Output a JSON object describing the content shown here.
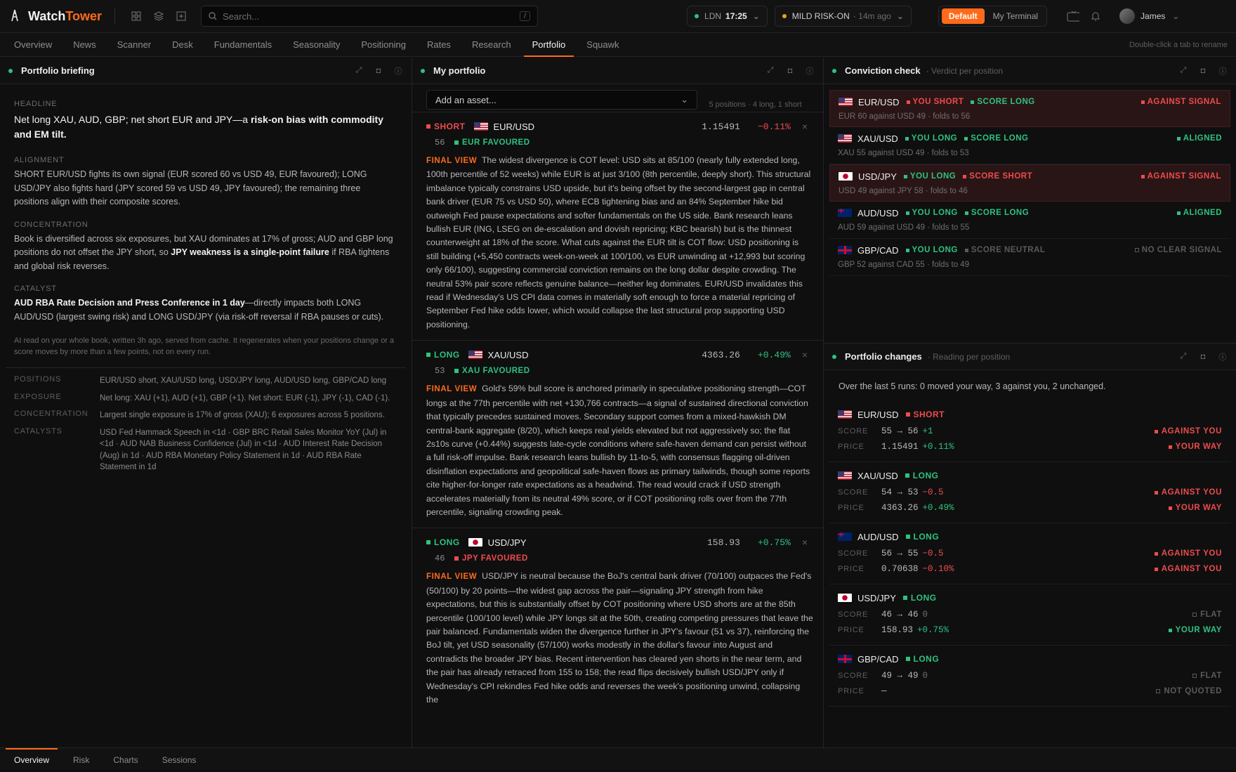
{
  "app": {
    "name_part1": "Watch",
    "name_part2": "Tower"
  },
  "search": {
    "placeholder": "Search...",
    "shortcut": "/"
  },
  "market": {
    "city": "LDN",
    "time": "17:25",
    "regime": "MILD RISK-ON",
    "regime_age": "· 14m ago"
  },
  "layout_toggle": {
    "active": "Default",
    "inactive": "My Terminal"
  },
  "user": {
    "name": "James"
  },
  "nav": {
    "tabs": [
      "Overview",
      "News",
      "Scanner",
      "Desk",
      "Fundamentals",
      "Seasonality",
      "Positioning",
      "Rates",
      "Research",
      "Portfolio",
      "Squawk"
    ],
    "active": "Portfolio",
    "hint": "Double-click a tab to rename"
  },
  "briefing": {
    "title": "Portfolio briefing",
    "headline_label": "HEADLINE",
    "headline_a": "Net long XAU, AUD, GBP; net short EUR and JPY—a ",
    "headline_b": "risk-on bias with commodity and EM tilt.",
    "alignment_label": "ALIGNMENT",
    "alignment_text": "SHORT EUR/USD fights its own signal (EUR scored 60 vs USD 49, EUR favoured); LONG USD/JPY also fights hard (JPY scored 59 vs USD 49, JPY favoured); the remaining three positions align with their composite scores.",
    "concentration_label": "CONCENTRATION",
    "concentration_a": "Book is diversified across six exposures, but XAU dominates at 17% of gross; AUD and GBP long positions do not offset the JPY short, so ",
    "concentration_b": "JPY weakness is a single-point failure",
    "concentration_c": " if RBA tightens and global risk reverses.",
    "catalyst_label": "CATALYST",
    "catalyst_a": "AUD RBA Rate Decision and Press Conference in 1 day",
    "catalyst_b": "—directly impacts both LONG AUD/USD (largest swing risk) and LONG USD/JPY (via risk-off reversal if RBA pauses or cuts).",
    "meta": "AI read on your whole book, written 3h ago, served from cache. It regenerates when your positions change or a score moves by more than a few points, not on every run.",
    "facts": [
      {
        "k": "POSITIONS",
        "v": "EUR/USD short, XAU/USD long, USD/JPY long, AUD/USD long, GBP/CAD long"
      },
      {
        "k": "EXPOSURE",
        "v": "Net long: XAU (+1), AUD (+1), GBP (+1). Net short: EUR (-1), JPY (-1), CAD (-1)."
      },
      {
        "k": "CONCENTRATION",
        "v": "Largest single exposure is 17% of gross (XAU); 6 exposures across 5 positions."
      },
      {
        "k": "CATALYSTS",
        "v": "USD Fed Hammack Speech in <1d · GBP BRC Retail Sales Monitor YoY (Jul) in <1d · AUD NAB Business Confidence (Jul) in <1d · AUD Interest Rate Decision (Aug) in 1d · AUD RBA Monetary Policy Statement in 1d · AUD RBA Rate Statement in 1d"
      }
    ]
  },
  "portfolio": {
    "title": "My portfolio",
    "add_placeholder": "Add an asset...",
    "count": "5 positions · 4 long, 1 short",
    "positions": [
      {
        "side": "SHORT",
        "sym": "EUR/USD",
        "price": "1.15491",
        "chg": "−0.11%",
        "score": "56",
        "fav": "EUR FAVOURED",
        "fv_label": "FINAL VIEW",
        "fv": "The widest divergence is COT level: USD sits at 85/100 (nearly fully extended long, 100th percentile of 52 weeks) while EUR is at just 3/100 (8th percentile, deeply short). This structural imbalance typically constrains USD upside, but it's being offset by the second-largest gap in central bank driver (EUR 75 vs USD 50), where ECB tightening bias and an 84% September hike bid outweigh Fed pause expectations and softer fundamentals on the US side. Bank research leans bullish EUR (ING, LSEG on de-escalation and dovish repricing; KBC bearish) but is the thinnest counterweight at 18% of the score. What cuts against the EUR tilt is COT flow: USD positioning is still building (+5,450 contracts week-on-week at 100/100, vs EUR unwinding at +12,993 but scoring only 66/100), suggesting commercial conviction remains on the long dollar despite crowding. The neutral 53% pair score reflects genuine balance—neither leg dominates. EUR/USD invalidates this read if Wednesday's US CPI data comes in materially soft enough to force a material repricing of September Fed hike odds lower, which would collapse the last structural prop supporting USD positioning."
      },
      {
        "side": "LONG",
        "sym": "XAU/USD",
        "price": "4363.26",
        "chg": "+0.49%",
        "score": "53",
        "fav": "XAU FAVOURED",
        "fv_label": "FINAL VIEW",
        "fv": "Gold's 59% bull score is anchored primarily in speculative positioning strength—COT longs at the 77th percentile with net +130,766 contracts—a signal of sustained directional conviction that typically precedes sustained moves. Secondary support comes from a mixed-hawkish DM central-bank aggregate (8/20), which keeps real yields elevated but not aggressively so; the flat 2s10s curve (+0.44%) suggests late-cycle conditions where safe-haven demand can persist without a full risk-off impulse. Bank research leans bullish by 11-to-5, with consensus flagging oil-driven disinflation expectations and geopolitical safe-haven flows as primary tailwinds, though some reports cite higher-for-longer rate expectations as a headwind. The read would crack if USD strength accelerates materially from its neutral 49% score, or if COT positioning rolls over from the 77th percentile, signaling crowding peak."
      },
      {
        "side": "LONG",
        "sym": "USD/JPY",
        "price": "158.93",
        "chg": "+0.75%",
        "score": "46",
        "fav": "JPY FAVOURED",
        "fv_label": "FINAL VIEW",
        "fv": "USD/JPY is neutral because the BoJ's central bank driver (70/100) outpaces the Fed's (50/100) by 20 points—the widest gap across the pair—signaling JPY strength from hike expectations, but this is substantially offset by COT positioning where USD shorts are at the 85th percentile (100/100 level) while JPY longs sit at the 50th, creating competing pressures that leave the pair balanced. Fundamentals widen the divergence further in JPY's favour (51 vs 37), reinforcing the BoJ tilt, yet USD seasonality (57/100) works modestly in the dollar's favour into August and contradicts the broader JPY bias. Recent intervention has cleared yen shorts in the near term, and the pair has already retraced from 155 to 158; the read flips decisively bullish USD/JPY only if Wednesday's CPI rekindles Fed hike odds and reverses the week's positioning unwind, collapsing the"
      }
    ]
  },
  "conviction": {
    "title": "Conviction check",
    "subtitle": "· Verdict per position",
    "rows": [
      {
        "sym": "EUR/USD",
        "you": "YOU SHORT",
        "score": "SCORE LONG",
        "verdict": "AGAINST SIGNAL",
        "detail": "EUR 60 against USD 49 · folds to 56"
      },
      {
        "sym": "XAU/USD",
        "you": "YOU LONG",
        "score": "SCORE LONG",
        "verdict": "ALIGNED",
        "detail": "XAU 55 against USD 49 · folds to 53"
      },
      {
        "sym": "USD/JPY",
        "you": "YOU LONG",
        "score": "SCORE SHORT",
        "verdict": "AGAINST SIGNAL",
        "detail": "USD 49 against JPY 58 · folds to 46"
      },
      {
        "sym": "AUD/USD",
        "you": "YOU LONG",
        "score": "SCORE LONG",
        "verdict": "ALIGNED",
        "detail": "AUD 59 against USD 49 · folds to 55"
      },
      {
        "sym": "GBP/CAD",
        "you": "YOU LONG",
        "score": "SCORE NEUTRAL",
        "verdict": "NO CLEAR SIGNAL",
        "detail": "GBP 52 against CAD 55 · folds to 49"
      }
    ]
  },
  "changes": {
    "title": "Portfolio changes",
    "subtitle": "· Reading per position",
    "summary": "Over the last 5 runs: 0 moved your way, 3 against you, 2 unchanged.",
    "score_label": "SCORE",
    "price_label": "PRICE",
    "rows": [
      {
        "sym": "EUR/USD",
        "side": "SHORT",
        "score": "55 → 56",
        "sdelta": "+1",
        "sres": "AGAINST YOU",
        "price": "1.15491",
        "pdelta": "+0.11%",
        "pres": "YOUR WAY"
      },
      {
        "sym": "XAU/USD",
        "side": "LONG",
        "score": "54 → 53",
        "sdelta": "−0.5",
        "sres": "AGAINST YOU",
        "price": "4363.26",
        "pdelta": "+0.49%",
        "pres": "YOUR WAY"
      },
      {
        "sym": "AUD/USD",
        "side": "LONG",
        "score": "56 → 55",
        "sdelta": "−0.5",
        "sres": "AGAINST YOU",
        "price": "0.70638",
        "pdelta": "−0.10%",
        "pres": "AGAINST YOU"
      },
      {
        "sym": "USD/JPY",
        "side": "LONG",
        "score": "46 → 46",
        "sdelta": "0",
        "sres": "FLAT",
        "price": "158.93",
        "pdelta": "+0.75%",
        "pres": "YOUR WAY"
      },
      {
        "sym": "GBP/CAD",
        "side": "LONG",
        "score": "49 → 49",
        "sdelta": "0",
        "sres": "FLAT",
        "price": "—",
        "pdelta": "",
        "pres": "NOT QUOTED"
      }
    ]
  },
  "footer": {
    "tabs": [
      "Overview",
      "Risk",
      "Charts",
      "Sessions"
    ],
    "active": "Overview"
  }
}
